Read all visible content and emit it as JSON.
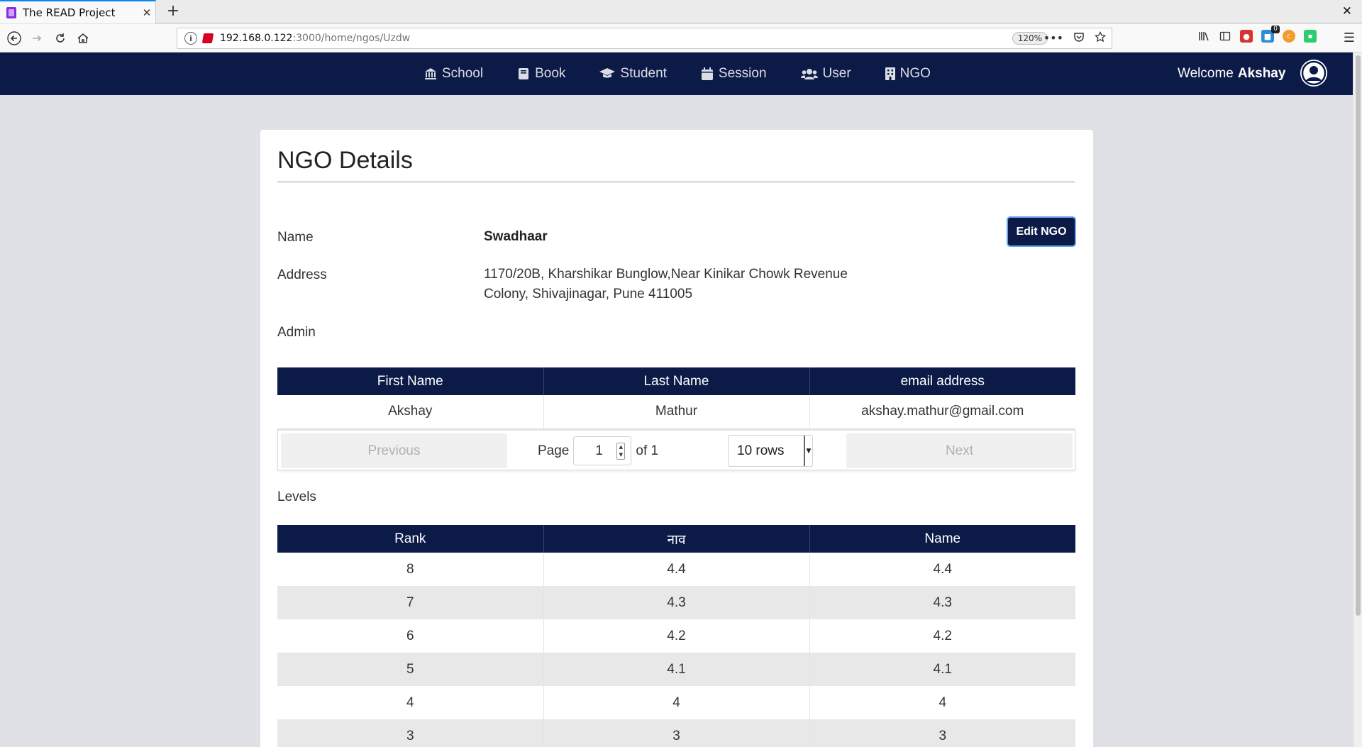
{
  "browser": {
    "tab_title": "The READ Project",
    "tab_close": "✕",
    "new_tab": "+",
    "window_close": "✕",
    "url_host": "192.168.0.122",
    "url_path": ":3000/home/ngos/Uzdw",
    "zoom": "120%",
    "badge_count": "0"
  },
  "app_nav": {
    "items": [
      {
        "label": "School",
        "icon": "bank-icon"
      },
      {
        "label": "Book",
        "icon": "book-icon"
      },
      {
        "label": "Student",
        "icon": "graduation-cap-icon"
      },
      {
        "label": "Session",
        "icon": "calendar-icon"
      },
      {
        "label": "User",
        "icon": "users-icon"
      },
      {
        "label": "NGO",
        "icon": "building-icon"
      }
    ],
    "welcome_prefix": "Welcome",
    "welcome_user": "Akshay"
  },
  "page": {
    "title": "NGO Details",
    "edit_button": "Edit NGO",
    "name_label": "Name",
    "name_value": "Swadhaar",
    "address_label": "Address",
    "address_value": "1170/20B, Kharshikar Bunglow,Near Kinikar Chowk Revenue Colony, Shivajinagar, Pune 411005",
    "admin_label": "Admin",
    "levels_label": "Levels"
  },
  "admin_table": {
    "columns": [
      "First Name",
      "Last Name",
      "email address"
    ],
    "rows": [
      [
        "Akshay",
        "Mathur",
        "akshay.mathur@gmail.com"
      ]
    ]
  },
  "pagination": {
    "previous": "Previous",
    "page_label": "Page",
    "page_value": "1",
    "of_label": "of 1",
    "rows_option": "10 rows",
    "next": "Next"
  },
  "levels_table": {
    "columns": [
      "Rank",
      "नाव",
      "Name"
    ],
    "rows": [
      [
        "8",
        "4.4",
        "4.4"
      ],
      [
        "7",
        "4.3",
        "4.3"
      ],
      [
        "6",
        "4.2",
        "4.2"
      ],
      [
        "5",
        "4.1",
        "4.1"
      ],
      [
        "4",
        "4",
        "4"
      ],
      [
        "3",
        "3",
        "3"
      ]
    ]
  },
  "colors": {
    "nav_bg": "#0b1a47",
    "page_bg": "#e0e1e6",
    "row_stripe": "#e8e8e8"
  }
}
